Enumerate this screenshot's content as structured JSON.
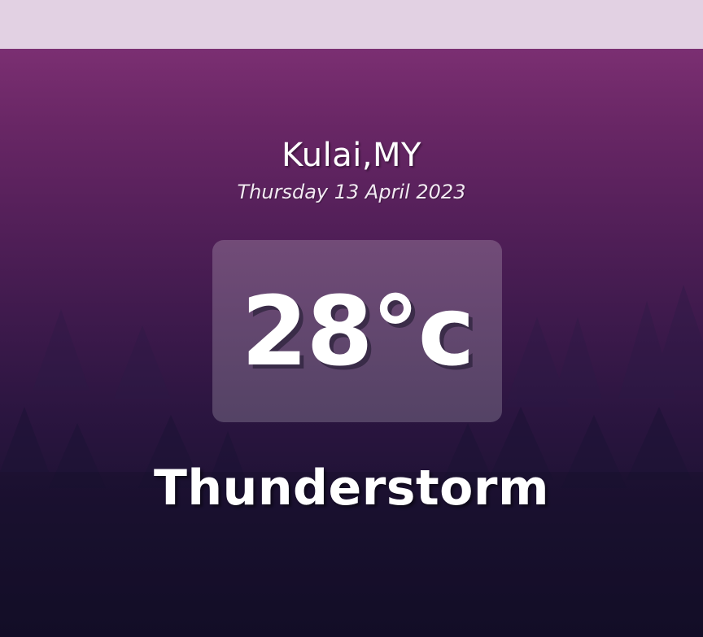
{
  "weather": {
    "location": "Kulai,MY",
    "date": "Thursday 13 April 2023",
    "temperature": "28°c",
    "condition": "Thunderstorm"
  },
  "colors": {
    "top_bar": "#e2d1e3",
    "gradient_top": "#7b2f72",
    "gradient_bottom": "#120d26",
    "text": "#ffffff"
  }
}
